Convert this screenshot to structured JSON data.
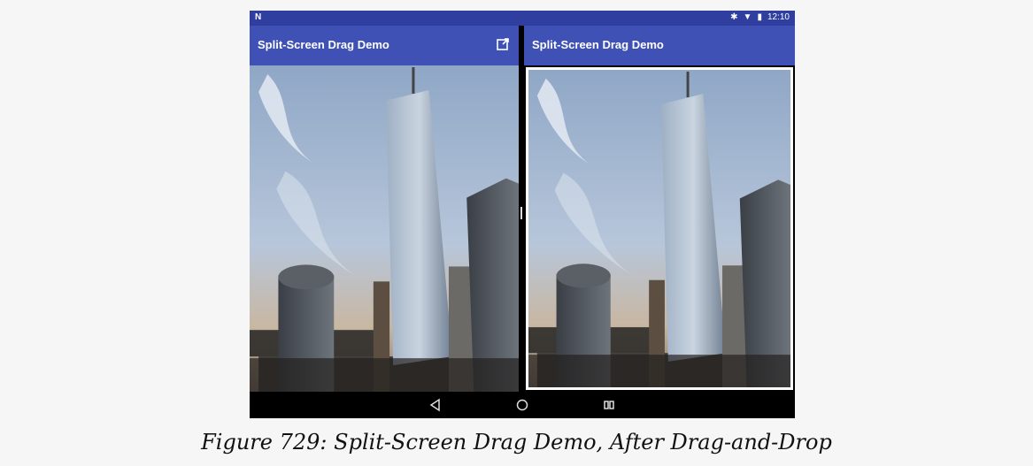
{
  "status_bar": {
    "left_icon": "N",
    "icons": [
      "bluetooth-icon",
      "wifi-icon",
      "battery-icon"
    ],
    "time": "12:10"
  },
  "left_pane": {
    "title": "Split-Screen Drag Demo",
    "action_icon": "open-in-new-window-icon"
  },
  "right_pane": {
    "title": "Split-Screen Drag Demo"
  },
  "nav_bar": {
    "buttons": [
      "back-icon",
      "home-icon",
      "recents-icon"
    ]
  },
  "caption": "Figure 729: Split-Screen Drag Demo, After Drag-and-Drop",
  "colors": {
    "status_bar": "#303f9f",
    "app_bar": "#3f51b5"
  }
}
